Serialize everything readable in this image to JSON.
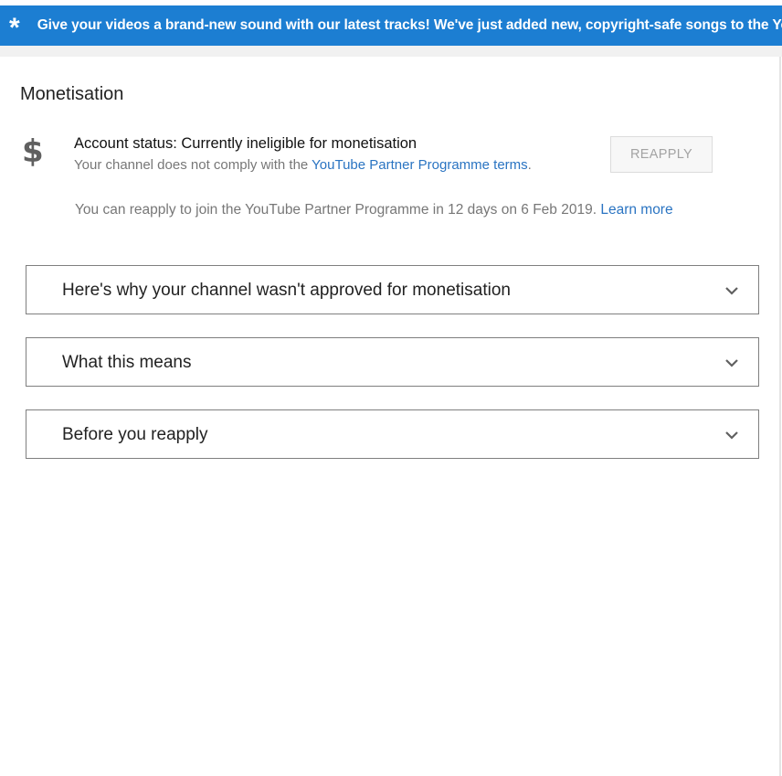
{
  "banner": {
    "icon": "asterisk-icon",
    "text": "Give your videos a brand-new sound with our latest tracks! We've just added new, copyright-safe songs to the YouTube Audio Library",
    "background_color": "#1c7ed2"
  },
  "page": {
    "title": "Monetisation"
  },
  "account": {
    "icon": "dollar-icon",
    "status_text": "Account status: Currently ineligible for monetisation",
    "compliance_prefix": "Your channel does not comply with the ",
    "compliance_link": "YouTube Partner Programme terms",
    "compliance_suffix": ".",
    "reapply_button_label": "REAPPLY",
    "reapply_info_text": "You can reapply to join the YouTube Partner Programme in 12 days on 6 Feb 2019. ",
    "learn_more_label": "Learn more"
  },
  "sections": [
    {
      "label": "Here's why your channel wasn't approved for monetisation",
      "icon": "chevron-down-icon"
    },
    {
      "label": "What this means",
      "icon": "chevron-down-icon"
    },
    {
      "label": "Before you reapply",
      "icon": "chevron-down-icon"
    }
  ],
  "colors": {
    "link": "#2a74c2",
    "muted_text": "#777777"
  }
}
